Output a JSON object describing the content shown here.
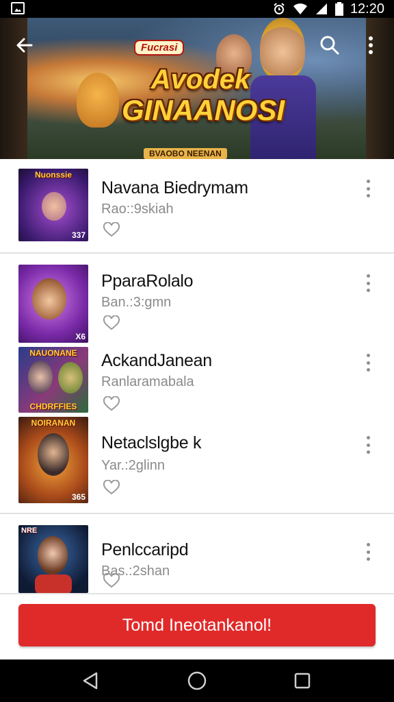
{
  "status_bar": {
    "time": "12:20"
  },
  "hero": {
    "badge": "Fucrasi",
    "title_line1": "Avodek",
    "title_line2": "GINAANOSI",
    "subtitle": "BVAOBO NEENAN"
  },
  "items": [
    {
      "title": "Navana Biedrymam",
      "subtitle": "Rao::9skiah",
      "thumb_caption": "Nuonssie",
      "thumb_number": "337"
    },
    {
      "title": "PparaRolalo",
      "subtitle": "Ban.:3:gmn",
      "thumb_caption": "",
      "thumb_number": "X6"
    },
    {
      "title": "AckandJanean",
      "subtitle": "Ranlaramabala",
      "thumb_caption": "NAUONANE",
      "thumb_number": "CHDRFFIES"
    },
    {
      "title": "Netaclslgbe k",
      "subtitle": "Yar.:2glinn",
      "thumb_caption": "NOIRANAN",
      "thumb_number": "365"
    },
    {
      "title": "Penlccaripd",
      "subtitle": "Bas.:2shan",
      "thumb_caption": "NRE",
      "thumb_number": ""
    }
  ],
  "cta": {
    "label": "Tomd Ineotankanol!"
  },
  "colors": {
    "accent": "#e02a2a",
    "divider": "#e2e2e2",
    "subtitle": "#8a8a8a"
  }
}
